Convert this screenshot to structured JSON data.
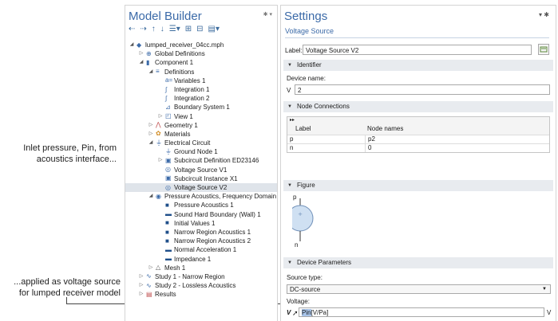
{
  "annotations": {
    "inlet": "Inlet pressure, Pin, from acoustics interface...",
    "applied": "...applied as voltage source for lumped receiver model"
  },
  "model_builder": {
    "title": "Model Builder",
    "toolbar_icons": [
      "arrow-left-icon",
      "arrow-right-icon",
      "arrow-up-icon",
      "arrow-down-icon",
      "show-icon",
      "expand-icon",
      "collapse-icon",
      "menu-icon"
    ],
    "tree": [
      {
        "label": "lumped_receiver_04cc.mph",
        "level": 0,
        "arrow": "down",
        "icon": "model-icon"
      },
      {
        "label": "Global Definitions",
        "level": 1,
        "arrow": "right",
        "icon": "globe-icon"
      },
      {
        "label": "Component 1",
        "level": 1,
        "arrow": "down",
        "icon": "component-icon"
      },
      {
        "label": "Definitions",
        "level": 2,
        "arrow": "down",
        "icon": "definitions-icon"
      },
      {
        "label": "Variables 1",
        "level": 3,
        "arrow": "",
        "icon": "variables-icon"
      },
      {
        "label": "Integration 1",
        "level": 3,
        "arrow": "",
        "icon": "integration-icon"
      },
      {
        "label": "Integration 2",
        "level": 3,
        "arrow": "",
        "icon": "integration-icon"
      },
      {
        "label": "Boundary System 1",
        "level": 3,
        "arrow": "",
        "icon": "boundary-system-icon"
      },
      {
        "label": "View 1",
        "level": 3,
        "arrow": "right",
        "icon": "view-icon"
      },
      {
        "label": "Geometry 1",
        "level": 2,
        "arrow": "right",
        "icon": "geometry-icon"
      },
      {
        "label": "Materials",
        "level": 2,
        "arrow": "right",
        "icon": "materials-icon"
      },
      {
        "label": "Electrical Circuit",
        "level": 2,
        "arrow": "down",
        "icon": "circuit-icon"
      },
      {
        "label": "Ground Node 1",
        "level": 3,
        "arrow": "",
        "icon": "ground-icon"
      },
      {
        "label": "Subcircuit Definition ED23146",
        "level": 3,
        "arrow": "right",
        "icon": "subcircuit-icon"
      },
      {
        "label": "Voltage Source V1",
        "level": 3,
        "arrow": "",
        "icon": "voltage-source-icon"
      },
      {
        "label": "Subcircuit Instance X1",
        "level": 3,
        "arrow": "",
        "icon": "subcircuit-icon"
      },
      {
        "label": "Voltage Source V2",
        "level": 3,
        "arrow": "",
        "icon": "voltage-source-icon",
        "selected": true
      },
      {
        "label": "Pressure Acoustics, Frequency Domain",
        "level": 2,
        "arrow": "down",
        "icon": "acoustics-icon"
      },
      {
        "label": "Pressure Acoustics 1",
        "level": 3,
        "arrow": "",
        "icon": "domain-feature-icon"
      },
      {
        "label": "Sound Hard Boundary (Wall) 1",
        "level": 3,
        "arrow": "",
        "icon": "boundary-feature-icon"
      },
      {
        "label": "Initial Values 1",
        "level": 3,
        "arrow": "",
        "icon": "domain-feature-icon"
      },
      {
        "label": "Narrow Region Acoustics 1",
        "level": 3,
        "arrow": "",
        "icon": "domain-feature-icon"
      },
      {
        "label": "Narrow Region Acoustics 2",
        "level": 3,
        "arrow": "",
        "icon": "domain-feature-icon"
      },
      {
        "label": "Normal Acceleration 1",
        "level": 3,
        "arrow": "",
        "icon": "boundary-feature-icon"
      },
      {
        "label": "Impedance 1",
        "level": 3,
        "arrow": "",
        "icon": "boundary-feature-icon"
      },
      {
        "label": "Mesh 1",
        "level": 2,
        "arrow": "right",
        "icon": "mesh-icon"
      },
      {
        "label": "Study 1 - Narrow Region",
        "level": 1,
        "arrow": "right",
        "icon": "study-icon"
      },
      {
        "label": "Study 2 - Lossless Acoustics",
        "level": 1,
        "arrow": "right",
        "icon": "study-icon"
      },
      {
        "label": "Results",
        "level": 1,
        "arrow": "right",
        "icon": "results-icon"
      }
    ]
  },
  "settings": {
    "title": "Settings",
    "subtitle": "Voltage Source",
    "label_caption": "Label:",
    "label_value": "Voltage Source V2",
    "sections": {
      "identifier": "Identifier",
      "node_connections": "Node Connections",
      "figure": "Figure",
      "device_parameters": "Device Parameters"
    },
    "device_name_caption": "Device name:",
    "device_prefix": "V",
    "device_name_value": "2",
    "table": {
      "headers": [
        "Label",
        "Node names"
      ],
      "rows": [
        [
          "p",
          "p2"
        ],
        [
          "n",
          "0"
        ]
      ]
    },
    "figure_labels": {
      "top": "p",
      "bottom": "n"
    },
    "source_type_caption": "Source type:",
    "source_type_value": "DC-source",
    "voltage_caption": "Voltage:",
    "voltage_symbol": "V",
    "voltage_highlight": "Pin",
    "voltage_rest": "[V/Pa]",
    "voltage_unit": "V",
    "colors": {
      "accent": "#3b6aa8",
      "section_bg": "#e8ebef",
      "selected_row": "#dfe4ea"
    }
  }
}
